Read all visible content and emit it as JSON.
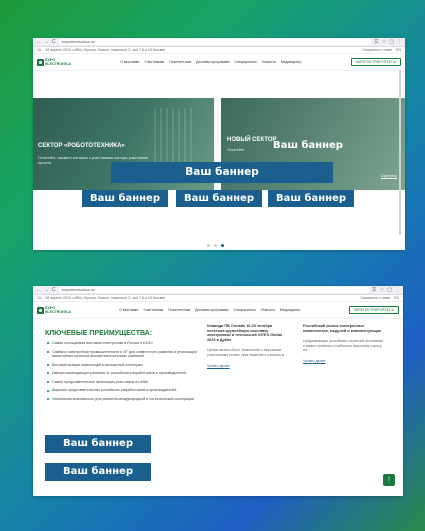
{
  "browser": {
    "url": "expoelectronica.ru/",
    "nav_back": "←",
    "nav_forward": "→",
    "nav_reload": "C",
    "icons": [
      "translate-icon",
      "star-icon",
      "extensions-icon",
      "menu-icon"
    ]
  },
  "site": {
    "info": "15 – 18 апреля 2024 • МВЦ «Крокус Экспо», павильон 2, зал 7,8 и 15 Москва",
    "contact": "Связаться с нами",
    "lang": "EN",
    "logo_line1": "EXPO",
    "logo_line2": "ELECTRONICA",
    "menu": [
      "О выставке",
      "Участникам",
      "Посетителям",
      "Деловая программа",
      "Спецпроекты",
      "Новости",
      "Медиацентр"
    ],
    "register": "ЗАРЕГИСТРИРУЙТЕСЬ"
  },
  "screen1": {
    "card_left_title": "СЕКТОР «РОБОТОТЕХНИКА»",
    "card_left_text": "Остатейте, нажмите контакты с участниками сектора, участников проекта",
    "card_right_title": "НОВЫЙ СЕКТОР",
    "card_right_text": "Остатейте",
    "more": "Смотреть",
    "hero_banner": "Ваш баннер",
    "banner_main": "Ваш баннер",
    "banner_small": [
      "Ваш баннер",
      "Ваш баннер",
      "Ваш баннер"
    ]
  },
  "screen2": {
    "title": "КЛЮЧЕВЫЕ ПРЕИМУЩЕСТВА:",
    "advantages": [
      "Самая посещаемая выставка электроники в России и ЕАЭС",
      "Симбиоз электронной промышленности и ИТ для совместного развития и реализации масштабных проектов высокотехнологичных компаний",
      "Высокий возврат инвестиций и экспортный потенциал",
      "Импортозамещающие решения от российских разработчиков и производителей",
      "Самое представительное экспозиция участников из ЮВА",
      "Широкое представительство российских разработчиков и производителей",
      "Уникальная возможность для развития международной и логистической кооперации"
    ],
    "news1_title": "Команда ПВ Онлайн 16-20 октября посетила крупнейшую выставку электроники и технологий GITEX Global 2023 в Дубае",
    "news1_text": "Целью визита было знакомство с мировыми участниками рынка, приглашение к участию в...",
    "news2_title": "Российский рынок электронных компонентов, модулей и комплектующих",
    "news2_text": "Цифровизация российских отраслей экономики и важно привела к стабильно высокому спросу на...",
    "news_more": "Читать далее",
    "banners": [
      "Ваш баннер",
      "Ваш баннер"
    ],
    "up": "↑"
  }
}
